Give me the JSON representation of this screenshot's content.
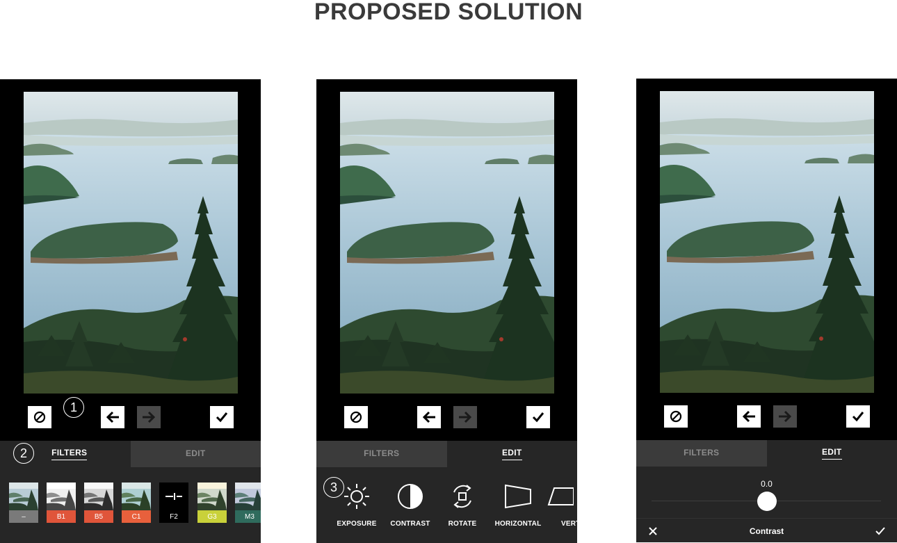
{
  "title": "PROPOSED SOLUTION",
  "annotations": [
    "1",
    "2",
    "3"
  ],
  "tabs": {
    "filters": "FILTERS",
    "edit": "EDIT"
  },
  "controls": [
    "cancel-icon",
    "undo-arrow-icon",
    "redo-arrow-icon",
    "confirm-check-icon"
  ],
  "filters": [
    {
      "label": "–",
      "color": "#7a7a7a"
    },
    {
      "label": "B1",
      "color": "#e0553a"
    },
    {
      "label": "B5",
      "color": "#e0553a"
    },
    {
      "label": "C1",
      "color": "#e8603c"
    },
    {
      "label": "F2",
      "color": "#000000"
    },
    {
      "label": "G3",
      "color": "#c9d13a"
    },
    {
      "label": "M3",
      "color": "#2f6b5d"
    }
  ],
  "tools": [
    {
      "label": "EXPOSURE",
      "icon": "exposure-sun-icon"
    },
    {
      "label": "CONTRAST",
      "icon": "contrast-half-circle-icon"
    },
    {
      "label": "ROTATE",
      "icon": "rotate-icon"
    },
    {
      "label": "HORIZONTAL",
      "icon": "horizontal-perspective-icon"
    },
    {
      "label": "VERT",
      "icon": "vertical-perspective-icon"
    }
  ],
  "adjust": {
    "value": "0.0",
    "caption": "Contrast"
  },
  "colors": {
    "accent_white": "#ffffff",
    "panel": "#262626",
    "tab_inactive": "#3b3b3b"
  }
}
